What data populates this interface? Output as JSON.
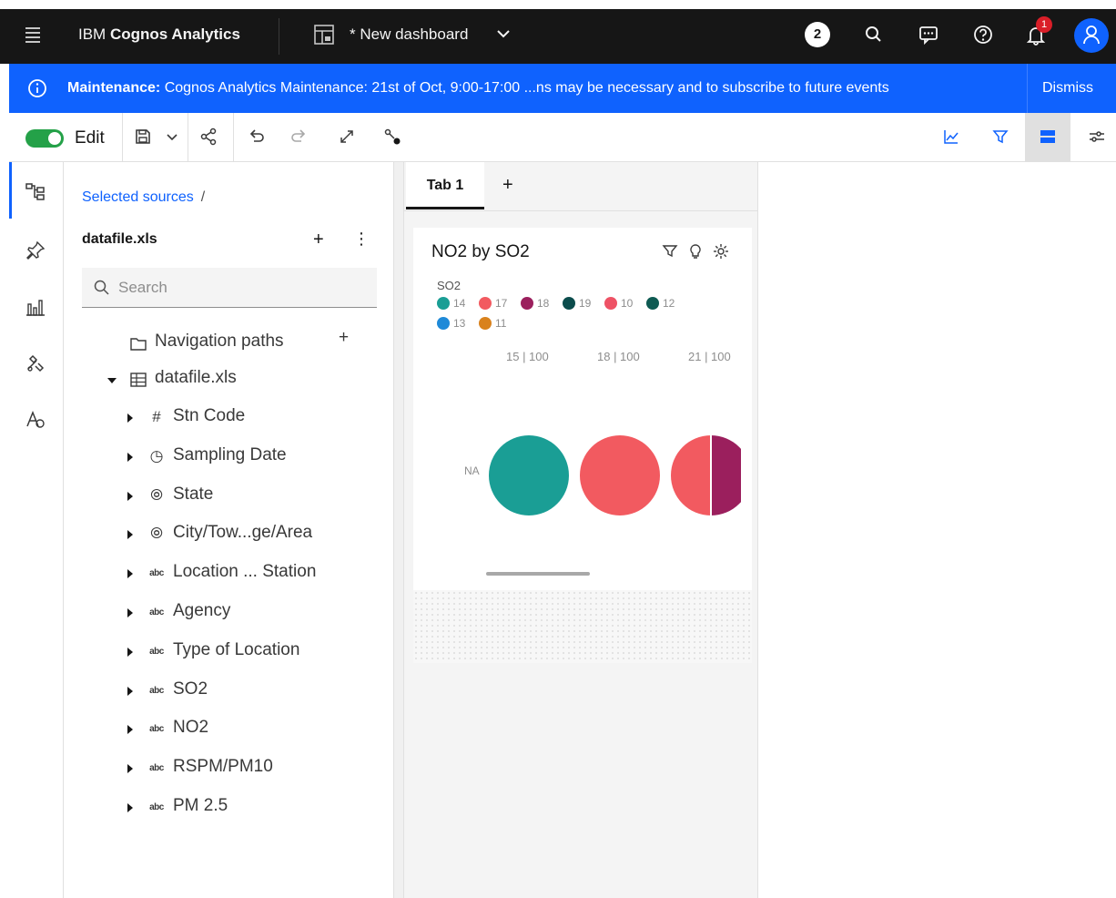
{
  "app": {
    "brand_prefix": "IBM",
    "brand_name": "Cognos Analytics",
    "dashboard_title": "* New dashboard",
    "badge_count": "2",
    "notification_count": "1"
  },
  "banner": {
    "label": "Maintenance:",
    "message": " Cognos Analytics Maintenance: 21st of Oct, 9:00-17:00 ...ns may be necessary and to subscribe to future events",
    "dismiss": "Dismiss"
  },
  "toolbar": {
    "edit_label": "Edit",
    "edit_enabled": true
  },
  "sources": {
    "breadcrumb": "Selected sources",
    "breadcrumb_sep": "/",
    "title": "datafile.xls",
    "search_placeholder": "Search",
    "navigation_paths": "Navigation paths",
    "datasource": "datafile.xls",
    "fields": [
      {
        "label": "Stn Code",
        "icon": "hash-icon"
      },
      {
        "label": "Sampling Date",
        "icon": "clock-icon"
      },
      {
        "label": "State",
        "icon": "location-icon"
      },
      {
        "label": "City/Tow...ge/Area",
        "icon": "location-icon"
      },
      {
        "label": "Location ... Station",
        "icon": "text-abc-icon"
      },
      {
        "label": "Agency",
        "icon": "text-abc-icon"
      },
      {
        "label": "Type of Location",
        "icon": "text-abc-icon"
      },
      {
        "label": "SO2",
        "icon": "text-abc-icon"
      },
      {
        "label": "NO2",
        "icon": "text-abc-icon"
      },
      {
        "label": "RSPM/PM10",
        "icon": "text-abc-icon"
      },
      {
        "label": "PM 2.5",
        "icon": "text-abc-icon"
      }
    ]
  },
  "canvas": {
    "tabs": [
      "Tab 1"
    ],
    "widget": {
      "title": "NO2 by SO2",
      "legend_title": "SO2",
      "legend": [
        {
          "label": "14",
          "color": "#1a9e95"
        },
        {
          "label": "17",
          "color": "#f25a60"
        },
        {
          "label": "18",
          "color": "#9b1f5d"
        },
        {
          "label": "19",
          "color": "#0b4c4c"
        },
        {
          "label": "10",
          "color": "#ee5265"
        },
        {
          "label": "12",
          "color": "#0e5a52"
        },
        {
          "label": "13",
          "color": "#1f8ad8"
        },
        {
          "label": "11",
          "color": "#d9821d"
        }
      ],
      "columns": [
        "15 | 100",
        "18 | 100",
        "21 | 100"
      ],
      "row_label": "NA"
    }
  }
}
